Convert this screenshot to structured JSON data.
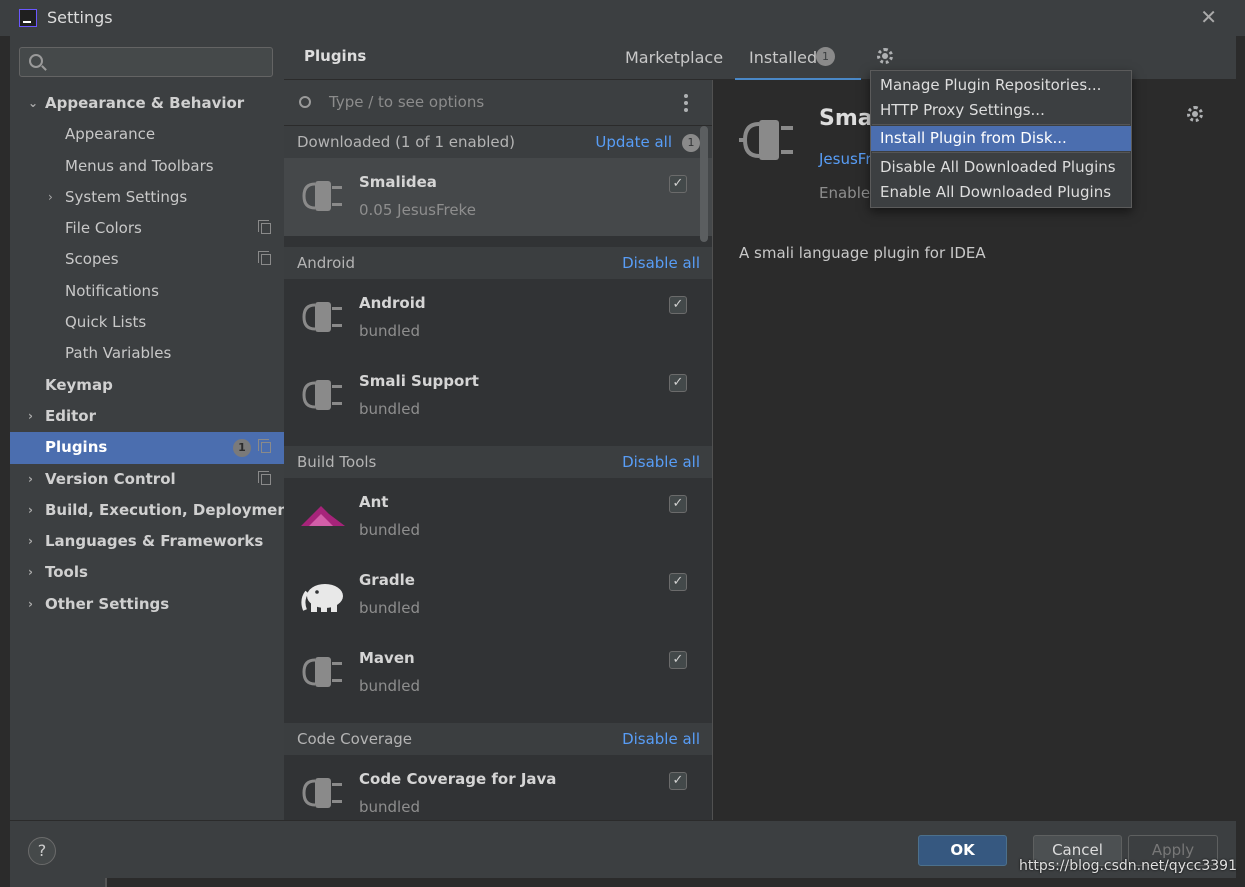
{
  "window": {
    "title": "Settings"
  },
  "sidebar": {
    "search_placeholder": "",
    "items": [
      {
        "label": "Appearance & Behavior",
        "arrow": "⌄",
        "bold": true
      },
      {
        "label": "Appearance"
      },
      {
        "label": "Menus and Toolbars"
      },
      {
        "label": "System Settings",
        "arrow": "›"
      },
      {
        "label": "File Colors",
        "copy": true
      },
      {
        "label": "Scopes",
        "copy": true
      },
      {
        "label": "Notifications"
      },
      {
        "label": "Quick Lists"
      },
      {
        "label": "Path Variables"
      },
      {
        "label": "Keymap",
        "bold": true
      },
      {
        "label": "Editor",
        "arrow": "›",
        "bold": true
      },
      {
        "label": "Plugins",
        "bold": true,
        "selected": true,
        "badge": "1",
        "copy": true
      },
      {
        "label": "Version Control",
        "arrow": "›",
        "bold": true,
        "copy": true
      },
      {
        "label": "Build, Execution, Deployment",
        "arrow": "›",
        "bold": true
      },
      {
        "label": "Languages & Frameworks",
        "arrow": "›",
        "bold": true
      },
      {
        "label": "Tools",
        "arrow": "›",
        "bold": true
      },
      {
        "label": "Other Settings",
        "arrow": "›",
        "bold": true
      }
    ]
  },
  "header": {
    "title": "Plugins",
    "tabs": [
      {
        "label": "Marketplace",
        "active": false
      },
      {
        "label": "Installed",
        "active": true,
        "badge": "1"
      }
    ],
    "gear_icon": "gear-icon"
  },
  "plugin_list": {
    "search_placeholder": "Type / to see options",
    "groups": [
      {
        "name": "Downloaded (1 of 1 enabled)",
        "action": "Update all",
        "badge": "1",
        "plugins": [
          {
            "name": "Smalidea",
            "sub": "0.05  JesusFreke",
            "checked": true,
            "selected": true,
            "icon": "plug-icon"
          }
        ]
      },
      {
        "name": "Android",
        "action": "Disable all",
        "plugins": [
          {
            "name": "Android",
            "sub": "bundled",
            "checked": true,
            "icon": "plug-icon"
          },
          {
            "name": "Smali Support",
            "sub": "bundled",
            "checked": true,
            "icon": "plug-icon"
          }
        ]
      },
      {
        "name": "Build Tools",
        "action": "Disable all",
        "plugins": [
          {
            "name": "Ant",
            "sub": "bundled",
            "checked": true,
            "icon": "ant-icon"
          },
          {
            "name": "Gradle",
            "sub": "bundled",
            "checked": true,
            "icon": "gradle-elephant-icon"
          },
          {
            "name": "Maven",
            "sub": "bundled",
            "checked": true,
            "icon": "plug-icon"
          }
        ]
      },
      {
        "name": "Code Coverage",
        "action": "Disable all",
        "plugins": [
          {
            "name": "Code Coverage for Java",
            "sub": "bundled",
            "checked": true,
            "icon": "plug-icon"
          }
        ]
      }
    ]
  },
  "detail": {
    "name": "Smal",
    "vendor": "JesusFr",
    "status": "Enabled",
    "description": "A smali language plugin for IDEA"
  },
  "gear_menu": {
    "items": [
      {
        "label": "Manage Plugin Repositories..."
      },
      {
        "label": "HTTP Proxy Settings..."
      },
      {
        "label": "Install Plugin from Disk...",
        "highlighted": true
      },
      {
        "label": "Disable All Downloaded Plugins"
      },
      {
        "label": "Enable All Downloaded Plugins"
      }
    ]
  },
  "footer": {
    "help": "?",
    "ok": "OK",
    "cancel": "Cancel",
    "apply": "Apply"
  },
  "watermark": "https://blog.csdn.net/qycc3391",
  "colors": {
    "accent": "#4b6eaf",
    "link": "#589df6",
    "ok_button": "#365880"
  }
}
